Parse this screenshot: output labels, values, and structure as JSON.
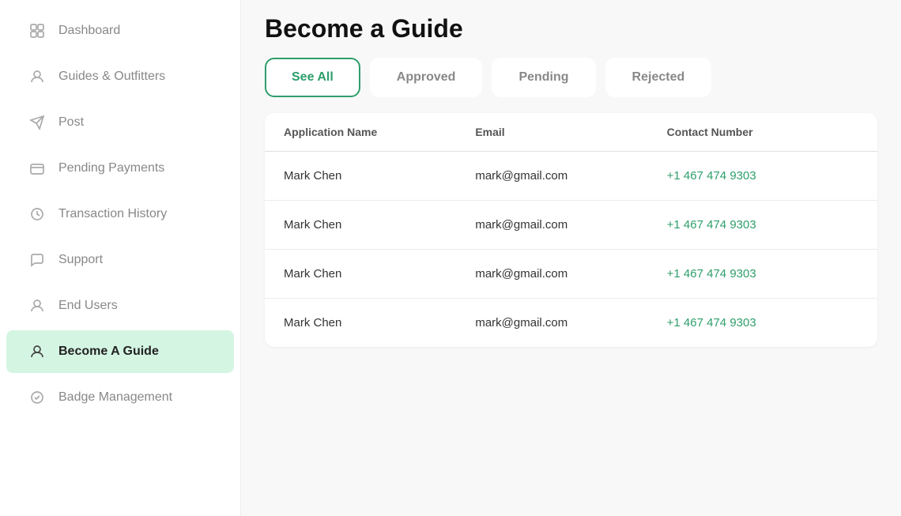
{
  "sidebar": {
    "items": [
      {
        "id": "dashboard",
        "label": "Dashboard",
        "icon": "grid"
      },
      {
        "id": "guides-outfitters",
        "label": "Guides & Outfitters",
        "icon": "person"
      },
      {
        "id": "post",
        "label": "Post",
        "icon": "send"
      },
      {
        "id": "pending-payments",
        "label": "Pending Payments",
        "icon": "card"
      },
      {
        "id": "transaction-history",
        "label": "Transaction History",
        "icon": "clock"
      },
      {
        "id": "support",
        "label": "Support",
        "icon": "chat"
      },
      {
        "id": "end-users",
        "label": "End Users",
        "icon": "person"
      },
      {
        "id": "become-a-guide",
        "label": "Become A Guide",
        "icon": "person",
        "active": true
      },
      {
        "id": "badge-management",
        "label": "Badge Management",
        "icon": "badge"
      }
    ]
  },
  "page": {
    "title": "Become a Guide"
  },
  "tabs": [
    {
      "id": "see-all",
      "label": "See All",
      "active": true
    },
    {
      "id": "approved",
      "label": "Approved",
      "active": false
    },
    {
      "id": "pending",
      "label": "Pending",
      "active": false
    },
    {
      "id": "rejected",
      "label": "Rejected",
      "active": false
    }
  ],
  "table": {
    "columns": [
      {
        "id": "name",
        "label": "Application Name"
      },
      {
        "id": "email",
        "label": "Email"
      },
      {
        "id": "contact",
        "label": "Contact Number"
      }
    ],
    "rows": [
      {
        "name": "Mark Chen",
        "email": "mark@gmail.com",
        "contact": "+1 467 474 9303"
      },
      {
        "name": "Mark Chen",
        "email": "mark@gmail.com",
        "contact": "+1 467 474 9303"
      },
      {
        "name": "Mark Chen",
        "email": "mark@gmail.com",
        "contact": "+1 467 474 9303"
      },
      {
        "name": "Mark Chen",
        "email": "mark@gmail.com",
        "contact": "+1 467 474 9303"
      }
    ]
  }
}
